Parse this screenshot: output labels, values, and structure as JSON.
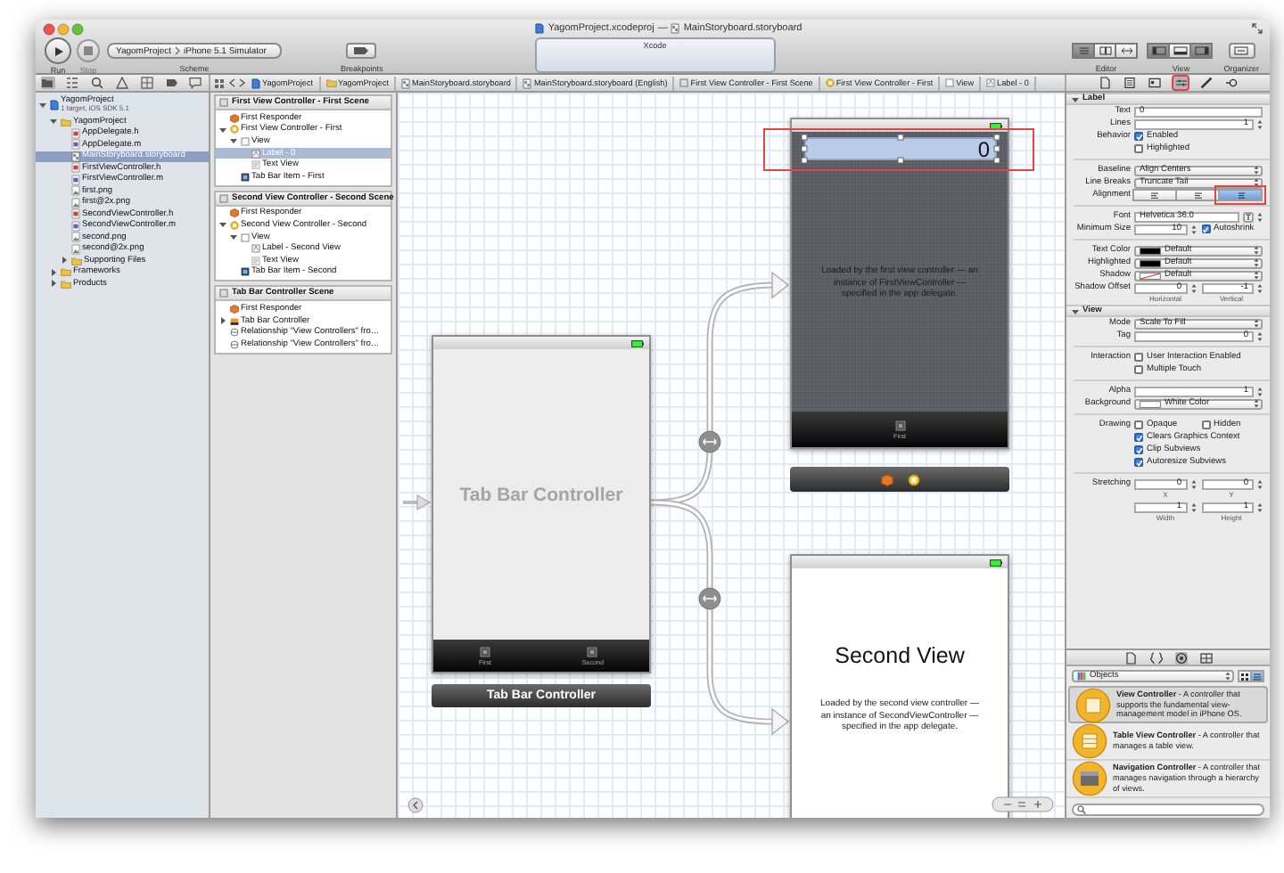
{
  "window": {
    "project_file": "YagomProject.xcodeproj",
    "separator": "—",
    "document": "MainStoryboard.storyboard"
  },
  "toolbar": {
    "run": {
      "label": "Run"
    },
    "stop": {
      "label": "Stop",
      "disabled": true
    },
    "scheme": {
      "label": "Scheme",
      "target": "YagomProject",
      "destination": "iPhone 5.1 Simulator"
    },
    "breakpoints": {
      "label": "Breakpoints"
    },
    "activity": {
      "title": "Xcode"
    },
    "editor": {
      "label": "Editor",
      "modes": [
        {
          "kind": "standard",
          "selected": true
        },
        {
          "kind": "assistant",
          "selected": false
        },
        {
          "kind": "version",
          "selected": false
        }
      ]
    },
    "view": {
      "label": "View",
      "panes": [
        {
          "kind": "navigator",
          "selected": true
        },
        {
          "kind": "debug",
          "selected": false
        },
        {
          "kind": "utilities",
          "selected": true
        }
      ]
    },
    "organizer": {
      "label": "Organizer"
    }
  },
  "navigator_tabs": [
    {
      "kind": "project",
      "selected": true
    },
    {
      "kind": "symbol",
      "selected": false
    },
    {
      "kind": "search",
      "selected": false
    },
    {
      "kind": "issue",
      "selected": false
    },
    {
      "kind": "debug",
      "selected": false
    },
    {
      "kind": "breakpoint",
      "selected": false
    },
    {
      "kind": "log",
      "selected": false
    }
  ],
  "jump_bar": [
    {
      "kind": "project",
      "text": "YagomProject"
    },
    {
      "kind": "folder",
      "text": "YagomProject"
    },
    {
      "kind": "storyboard",
      "text": "MainStoryboard.storyboard"
    },
    {
      "kind": "storyboard",
      "text": "MainStoryboard.storyboard (English)"
    },
    {
      "kind": "scene",
      "text": "First View Controller - First Scene"
    },
    {
      "kind": "controller",
      "text": "First View Controller - First"
    },
    {
      "kind": "view",
      "text": "View"
    },
    {
      "kind": "label",
      "text": "Label - 0"
    }
  ],
  "inspector_tabs": [
    {
      "kind": "file",
      "selected": false,
      "callout": false
    },
    {
      "kind": "quick_help",
      "selected": false,
      "callout": false
    },
    {
      "kind": "identity",
      "selected": false,
      "callout": false
    },
    {
      "kind": "attributes",
      "selected": true,
      "callout": true
    },
    {
      "kind": "size",
      "selected": false,
      "callout": false
    },
    {
      "kind": "connections",
      "selected": false,
      "callout": false
    }
  ],
  "navigator": {
    "items": [
      {
        "kind": "project",
        "name": "YagomProject",
        "subtitle": "1 target, iOS SDK 5.1",
        "expanded": true,
        "selected": false,
        "children": [
          {
            "kind": "folder",
            "name": "YagomProject",
            "expanded": true,
            "selected": false,
            "children": [
              {
                "kind": "header",
                "name": "AppDelegate.h",
                "selected": false
              },
              {
                "kind": "source",
                "name": "AppDelegate.m",
                "selected": false
              },
              {
                "kind": "storyboard",
                "name": "MainStoryboard.storyboard",
                "selected": true
              },
              {
                "kind": "header",
                "name": "FirstViewController.h",
                "selected": false
              },
              {
                "kind": "source",
                "name": "FirstViewController.m",
                "selected": false
              },
              {
                "kind": "image",
                "name": "first.png",
                "selected": false
              },
              {
                "kind": "image",
                "name": "first@2x.png",
                "selected": false
              },
              {
                "kind": "header",
                "name": "SecondViewController.h",
                "selected": false
              },
              {
                "kind": "source",
                "name": "SecondViewController.m",
                "selected": false
              },
              {
                "kind": "image",
                "name": "second.png",
                "selected": false
              },
              {
                "kind": "image",
                "name": "second@2x.png",
                "selected": false
              },
              {
                "kind": "folder",
                "name": "Supporting Files",
                "expanded": false,
                "selected": false
              }
            ]
          },
          {
            "kind": "folder",
            "name": "Frameworks",
            "expanded": false,
            "selected": false
          },
          {
            "kind": "folder",
            "name": "Products",
            "expanded": false,
            "selected": false
          }
        ]
      }
    ]
  },
  "outline": {
    "scenes": [
      {
        "title": "First View Controller - First Scene",
        "items": [
          {
            "kind": "responder",
            "name": "First Responder",
            "selected": false
          },
          {
            "kind": "controller",
            "name": "First View Controller - First",
            "expanded": true,
            "selected": false,
            "children": [
              {
                "kind": "view",
                "name": "View",
                "expanded": true,
                "selected": false,
                "children": [
                  {
                    "kind": "label",
                    "name": "Label - 0",
                    "selected": true
                  },
                  {
                    "kind": "textview",
                    "name": "Text View",
                    "selected": false
                  }
                ]
              },
              {
                "kind": "tabitem",
                "name": "Tab Bar Item - First",
                "selected": false
              }
            ]
          }
        ]
      },
      {
        "title": "Second View Controller - Second Scene",
        "items": [
          {
            "kind": "responder",
            "name": "First Responder",
            "selected": false
          },
          {
            "kind": "controller",
            "name": "Second View Controller - Second",
            "expanded": true,
            "selected": false,
            "children": [
              {
                "kind": "view",
                "name": "View",
                "expanded": true,
                "selected": false,
                "children": [
                  {
                    "kind": "label",
                    "name": "Label - Second View",
                    "selected": false
                  },
                  {
                    "kind": "textview",
                    "name": "Text View",
                    "selected": false
                  }
                ]
              },
              {
                "kind": "tabitem",
                "name": "Tab Bar Item - Second",
                "selected": false
              }
            ]
          }
        ]
      },
      {
        "title": "Tab Bar Controller Scene",
        "items": [
          {
            "kind": "responder",
            "name": "First Responder",
            "selected": false
          },
          {
            "kind": "tabbar",
            "name": "Tab Bar Controller",
            "expanded": false,
            "selected": false
          },
          {
            "kind": "relationship",
            "name": "Relationship \"View Controllers\" fro…",
            "selected": false
          },
          {
            "kind": "relationship",
            "name": "Relationship \"View Controllers\" fro…",
            "selected": false
          }
        ]
      }
    ]
  },
  "canvas": {
    "tab_bar_controller": {
      "title": "Tab Bar Controller",
      "tabs": [
        "First",
        "Second"
      ],
      "caption": "Tab Bar Controller"
    },
    "first_scene": {
      "label": {
        "text": "0",
        "selected": true,
        "callout": true
      },
      "description": "Loaded by the first view controller — an instance of FirstViewController — specified in the app delegate.",
      "tab": "First"
    },
    "second_scene": {
      "heading": "Second View",
      "description": "Loaded by the second view controller — an instance of SecondViewController — specified in the app delegate."
    }
  },
  "inspector": {
    "sections": [
      {
        "title": "Label",
        "expanded": true,
        "rows": [
          {
            "kind": "text",
            "label": "Text",
            "value": "0"
          },
          {
            "kind": "stepper",
            "label": "Lines",
            "value": "1"
          },
          {
            "kind": "check",
            "label": "Behavior",
            "text": "Enabled",
            "checked": true
          },
          {
            "kind": "check",
            "text": "Highlighted",
            "checked": false
          },
          {
            "kind": "separator"
          },
          {
            "kind": "popup",
            "label": "Baseline",
            "value": "Align Centers"
          },
          {
            "kind": "popup",
            "label": "Line Breaks",
            "value": "Truncate Tail"
          },
          {
            "kind": "segmented",
            "label": "Alignment",
            "options": [
              {
                "kind": "left",
                "selected": false,
                "callout": false
              },
              {
                "kind": "center",
                "selected": false,
                "callout": false
              },
              {
                "kind": "right",
                "selected": true,
                "callout": true
              }
            ]
          },
          {
            "kind": "separator"
          },
          {
            "kind": "font",
            "label": "Font",
            "value": "Helvetica 36.0"
          },
          {
            "kind": "stepper_check",
            "label": "Minimum Size",
            "value": "10",
            "text": "Autoshrink",
            "checked": true
          },
          {
            "kind": "separator"
          },
          {
            "kind": "color",
            "label": "Text Color",
            "color": "#000000",
            "clear": false,
            "value": "Default"
          },
          {
            "kind": "color",
            "label": "Highlighted",
            "color": "#000000",
            "clear": false,
            "value": "Default"
          },
          {
            "kind": "color",
            "label": "Shadow",
            "color": "#ffffff",
            "clear": true,
            "value": "Default"
          },
          {
            "kind": "pair",
            "label": "Shadow Offset",
            "values": [
              "0",
              "-1"
            ],
            "captions": [
              "Horizontal",
              "Vertical"
            ]
          }
        ]
      },
      {
        "title": "View",
        "expanded": true,
        "rows": [
          {
            "kind": "popup",
            "label": "Mode",
            "value": "Scale To Fill"
          },
          {
            "kind": "stepper",
            "label": "Tag",
            "value": "0"
          },
          {
            "kind": "separator"
          },
          {
            "kind": "check",
            "label": "Interaction",
            "text": "User Interaction Enabled",
            "checked": false
          },
          {
            "kind": "check",
            "text": "Multiple Touch",
            "checked": false
          },
          {
            "kind": "separator"
          },
          {
            "kind": "stepper",
            "label": "Alpha",
            "value": "1"
          },
          {
            "kind": "color",
            "label": "Background",
            "color": "#ffffff",
            "clear": false,
            "value": "White Color"
          },
          {
            "kind": "separator"
          },
          {
            "kind": "check2",
            "label": "Drawing",
            "items": [
              {
                "text": "Opaque",
                "checked": false
              },
              {
                "text": "Hidden",
                "checked": false
              }
            ]
          },
          {
            "kind": "check",
            "text": "Clears Graphics Context",
            "checked": true
          },
          {
            "kind": "check",
            "text": "Clip Subviews",
            "checked": true
          },
          {
            "kind": "check",
            "text": "Autoresize Subviews",
            "checked": true
          },
          {
            "kind": "separator"
          },
          {
            "kind": "pair",
            "label": "Stretching",
            "values": [
              "0",
              "0"
            ],
            "captions": [
              "X",
              "Y"
            ]
          },
          {
            "kind": "pair",
            "values": [
              "1",
              "1"
            ],
            "captions": [
              "Width",
              "Height"
            ]
          }
        ]
      }
    ]
  },
  "library": {
    "tabs": [
      {
        "kind": "file",
        "selected": false
      },
      {
        "kind": "code",
        "selected": false
      },
      {
        "kind": "object",
        "selected": true
      },
      {
        "kind": "media",
        "selected": false
      }
    ],
    "filter": "Objects",
    "view_modes": [
      {
        "kind": "grid",
        "selected": false
      },
      {
        "kind": "list",
        "selected": true
      }
    ],
    "items": [
      {
        "kind": "view_controller",
        "text": "**View Controller** - A controller that supports the fundamental view-management model in iPhone OS.",
        "selected": true
      },
      {
        "kind": "table_controller",
        "text": "**Table View Controller** - A controller that manages a table view.",
        "selected": false
      },
      {
        "kind": "navigation_controller",
        "text": "**Navigation Controller** - A controller that manages navigation through a hierarchy of views.",
        "selected": false
      }
    ]
  }
}
